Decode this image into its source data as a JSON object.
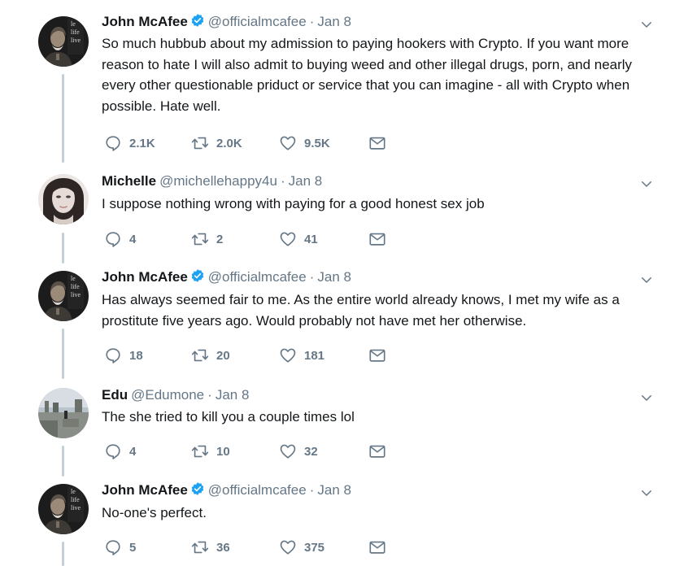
{
  "tweets": [
    {
      "name": "John McAfee",
      "verified": true,
      "handle": "@officialmcafee",
      "date": "Jan 8",
      "avatar_text": [
        "le",
        "life",
        "live"
      ],
      "text": "So much hubbub about my admission to paying hookers with Crypto. If you want more reason to hate I will also admit to buying weed and other illegal drugs, porn, and nearly every other questionable priduct or service that you can imagine - all with Crypto when possible. Hate well.",
      "replies": "2.1K",
      "retweets": "2.0K",
      "likes": "9.5K"
    },
    {
      "name": "Michelle",
      "verified": false,
      "handle": "@michellehappy4u",
      "date": "Jan 8",
      "text": "I suppose nothing wrong with paying for a good honest sex job",
      "replies": "4",
      "retweets": "2",
      "likes": "41"
    },
    {
      "name": "John McAfee",
      "verified": true,
      "handle": "@officialmcafee",
      "date": "Jan 8",
      "avatar_text": [
        "le",
        "life",
        "live"
      ],
      "text": "Has always seemed fair to me. As the entire world already knows, I met my wife as a prostitute five years ago. Would probably not have met her otherwise.",
      "replies": "18",
      "retweets": "20",
      "likes": "181"
    },
    {
      "name": "Edu",
      "verified": false,
      "handle": "@Edumone",
      "date": "Jan 8",
      "text": "The she tried to kill you a couple times lol",
      "replies": "4",
      "retweets": "10",
      "likes": "32"
    },
    {
      "name": "John McAfee",
      "verified": true,
      "handle": "@officialmcafee",
      "date": "Jan 8",
      "avatar_text": [
        "le",
        "life",
        "live"
      ],
      "text": "No-one's perfect.",
      "replies": "5",
      "retweets": "36",
      "likes": "375"
    }
  ],
  "separator": "·",
  "icons": {
    "reply": "reply-icon",
    "retweet": "retweet-icon",
    "like": "like-icon",
    "dm": "direct-message-icon",
    "caret": "chevron-down-icon",
    "verified": "verified-badge-icon"
  },
  "colors": {
    "name": "#14171a",
    "secondary": "#657786",
    "verified": "#1da1f2",
    "thread_line": "#c4cfd6"
  }
}
